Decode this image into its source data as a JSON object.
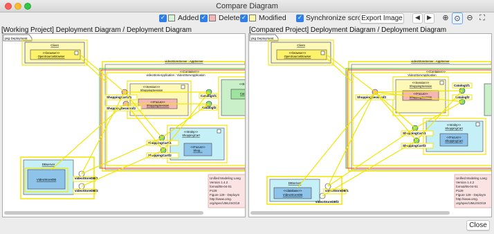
{
  "window": {
    "title": "Compare Diagram"
  },
  "toolbar": {
    "added_label": "Added",
    "deleted_label": "Deleted",
    "modified_label": "Modified",
    "sync_label": "Synchronize scroll",
    "export_label": "Export Image",
    "colors": {
      "added": "#d6f5d6",
      "deleted": "#f3b7b7",
      "modified": "#fff9a8",
      "checkbox": "#2f7fe8"
    }
  },
  "left": {
    "title": "[Working Project] Deployment Diagram / Deployment Diagram",
    "tab": "pkg Deployment",
    "client_name": "Client",
    "browser_stereo": "<<browser>>",
    "browser_name": "OpenSourceBrowser",
    "server_name": "videoStoreServer : AppServer",
    "container_stereo": "<<Container>>",
    "container_name": "videoStoreApplication : VideoStoreApplication",
    "session_stereo": "<<Session>>",
    "session_name": "ShoppingSession",
    "focus_stereo": "<<Focus>>",
    "focus_name": "ShoppingSession",
    "entity_stereo": "<<Entity>>",
    "entity_name": "ShoppingCart",
    "entity_focus_stereo": "<<Focus>>",
    "entity_focus_name": "Shop...",
    "right_stereo": "<<E",
    "right_name": "Cat",
    "port_shop1": "ShoppingCart1f1",
    "port_shop2": "ShoppingSessionf2",
    "port_cat1": "Catalog1f1",
    "port_cat2": "Catalogf2",
    "port_sc1": "ShoppingCartf1",
    "port_sc2": "ShoppingCartf2",
    "db_name": "DBserver",
    "db_inner": "VideoStoreDB",
    "db_port1": "videoStoreDBf1",
    "db_port2": "videoStoreDBf2",
    "note": [
      "Unified Modeling Lang",
      "Version 1.4.2",
      "formal/05-04-01",
      "P129",
      "Figure 129 - Deploym",
      "http://www.omg.",
      "org/spec/UML/ISO/19"
    ]
  },
  "right": {
    "title": "[Compared Project] Deployment Diagram / Deployment Diagram",
    "tab": "pkg Deployment",
    "client_name": "Client",
    "browser_stereo": "<<browser>>",
    "browser_name": "OpenSourceBrowser",
    "server_name": "videoStoreServer : AppServer",
    "container_stereo": "<<Container>>",
    "container_name": "VideoStoreApplication",
    "session_stereo": "<<Session>>",
    "session_name": "ShoppingSession",
    "focus_stereo": "<<Focus>>",
    "focus_name": "ShoppingSession",
    "entity_stereo": "<<Entity>>",
    "entity_name": "ShoppingCart",
    "entity_focus_stereo": "<<Focus>>",
    "entity_focus_name": "ShoppingCart",
    "port_cat1": "Catalog1f1",
    "port_cat2": "Catalogf2",
    "port_sc1": "ShoppingCartf1",
    "port_sc2": "ShoppingCartf2",
    "port_sess": "ShoppingSessionf2",
    "db_name": "DBserver",
    "db_inner_stereo": "<<database>>",
    "db_inner": "VideoStoreDB",
    "db_port1": "videoStoreDBf1",
    "db_port2": "videoStoreDBf2",
    "note": [
      "Unified Modeling Lang",
      "Version 1.4.2",
      "formal/05-04-01",
      "P129",
      "Figure 129 - Deploym",
      "http://www.omg.",
      "org/spec/UML/ISO/19"
    ]
  },
  "footer": {
    "close_label": "Close"
  }
}
